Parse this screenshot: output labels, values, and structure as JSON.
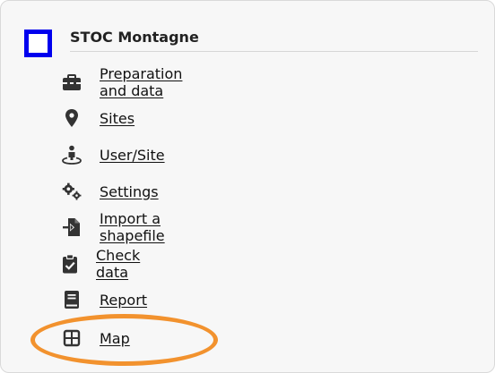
{
  "panel": {
    "title": "STOC Montagne",
    "title_icon": "square-outline-icon",
    "accent_color": "#0000ee"
  },
  "menu": {
    "items": [
      {
        "label": "Preparation and data",
        "icon": "toolbox-icon"
      },
      {
        "label": "Sites",
        "icon": "map-pin-icon"
      },
      {
        "label": "User/Site",
        "icon": "user-location-icon"
      },
      {
        "label": "Settings",
        "icon": "gears-icon"
      },
      {
        "label": "Import a shapefile",
        "icon": "file-import-icon"
      },
      {
        "label": "Check data",
        "icon": "clipboard-check-icon"
      },
      {
        "label": "Report",
        "icon": "book-icon"
      },
      {
        "label": "Map",
        "icon": "grid-icon"
      }
    ]
  },
  "annotation": {
    "highlight_color": "#f2922e",
    "highlighted_item": "Map"
  }
}
